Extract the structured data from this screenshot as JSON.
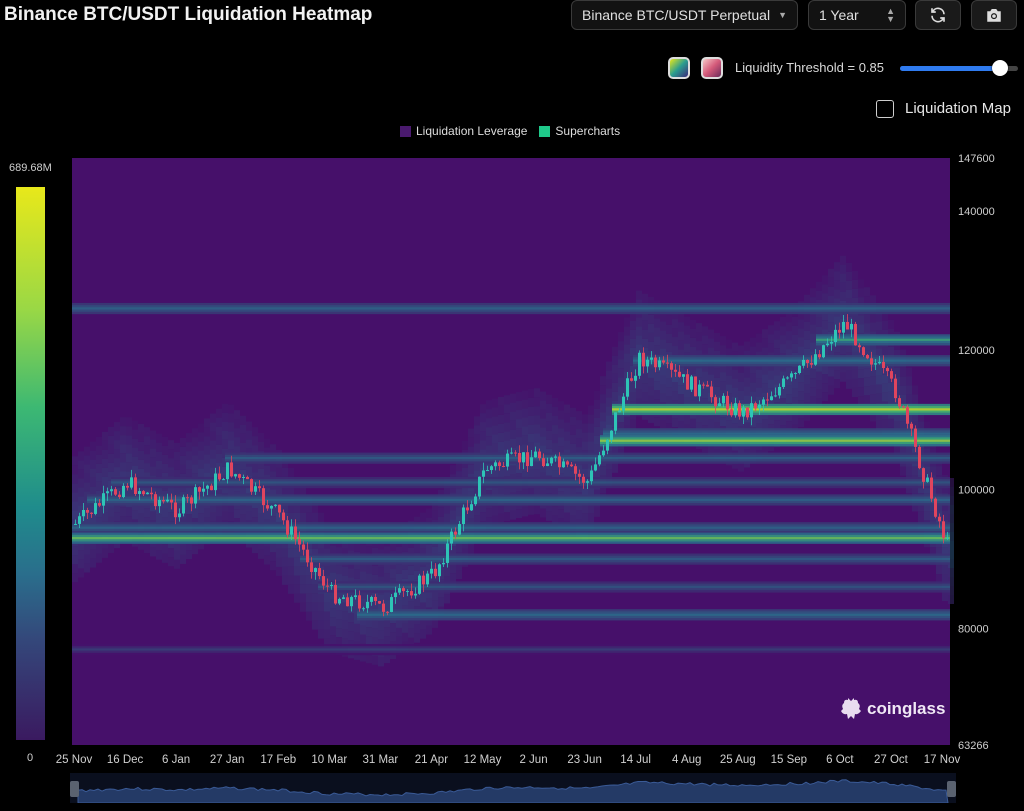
{
  "header": {
    "title": "Binance BTC/USDT Liquidation Heatmap",
    "pair_select": "Binance BTC/USDT Perpetual",
    "range_select": "1 Year",
    "refresh_icon": "refresh-icon",
    "camera_icon": "camera-icon"
  },
  "controls": {
    "threshold_label": "Liquidity Threshold = 0.85",
    "threshold_value": 0.85,
    "liquidation_map_label": "Liquidation Map",
    "liquidation_map_checked": false,
    "palette_swatches": [
      "viridis",
      "pink"
    ]
  },
  "colorbar": {
    "max_label": "689.68M",
    "min_label": "0"
  },
  "watermark": "coinglass",
  "colors": {
    "background": "#000000",
    "heatmap_base": "#46106a",
    "legend_leverage": "#4a1a6e",
    "legend_supercharts": "#1fc98a",
    "candle_up": "#2ec4b6",
    "candle_down": "#e0455e",
    "accent": "#2f7bf0"
  },
  "chart_data": {
    "type": "heatmap",
    "title": "Binance BTC/USDT Liquidation Heatmap",
    "legend": [
      "Liquidation Leverage",
      "Supercharts"
    ],
    "legend_placement": "top-center",
    "x_tick_labels": [
      "25 Nov",
      "16 Dec",
      "6 Jan",
      "27 Jan",
      "17 Feb",
      "10 Mar",
      "31 Mar",
      "21 Apr",
      "12 May",
      "2 Jun",
      "23 Jun",
      "14 Jul",
      "4 Aug",
      "25 Aug",
      "15 Sep",
      "6 Oct",
      "27 Oct",
      "17 Nov"
    ],
    "y_tick_labels": [
      "147600",
      "140000",
      "120000",
      "100000",
      "80000",
      "63266"
    ],
    "y_ticks": [
      147600,
      140000,
      120000,
      100000,
      80000,
      63266
    ],
    "ylim": [
      63266,
      147600
    ],
    "colorbar_range": [
      0,
      689680000
    ],
    "price_path": [
      {
        "date": "25 Nov",
        "close": 95000
      },
      {
        "date": "16 Dec",
        "close": 101000
      },
      {
        "date": "6 Jan",
        "close": 97000
      },
      {
        "date": "27 Jan",
        "close": 103000
      },
      {
        "date": "17 Feb",
        "close": 96000
      },
      {
        "date": "10 Mar",
        "close": 85000
      },
      {
        "date": "31 Mar",
        "close": 83000
      },
      {
        "date": "21 Apr",
        "close": 88000
      },
      {
        "date": "12 May",
        "close": 103000
      },
      {
        "date": "2 Jun",
        "close": 105000
      },
      {
        "date": "23 Jun",
        "close": 101000
      },
      {
        "date": "14 Jul",
        "close": 119000
      },
      {
        "date": "4 Aug",
        "close": 115000
      },
      {
        "date": "25 Aug",
        "close": 111000
      },
      {
        "date": "15 Sep",
        "close": 116000
      },
      {
        "date": "6 Oct",
        "close": 124000
      },
      {
        "date": "27 Oct",
        "close": 114000
      },
      {
        "date": "17 Nov",
        "close": 92000
      }
    ],
    "liquidity_bands": [
      {
        "price": 126000,
        "intensity": 0.55
      },
      {
        "price": 121500,
        "intensity": 0.75
      },
      {
        "price": 118500,
        "intensity": 0.6
      },
      {
        "price": 111500,
        "intensity": 0.95
      },
      {
        "price": 108000,
        "intensity": 0.6
      },
      {
        "price": 107000,
        "intensity": 0.9
      },
      {
        "price": 104500,
        "intensity": 0.5
      },
      {
        "price": 101000,
        "intensity": 0.45
      },
      {
        "price": 98500,
        "intensity": 0.55
      },
      {
        "price": 94500,
        "intensity": 0.55
      },
      {
        "price": 93000,
        "intensity": 0.85
      },
      {
        "price": 90000,
        "intensity": 0.5
      },
      {
        "price": 86000,
        "intensity": 0.45
      },
      {
        "price": 82000,
        "intensity": 0.6
      },
      {
        "price": 77000,
        "intensity": 0.3
      }
    ]
  }
}
